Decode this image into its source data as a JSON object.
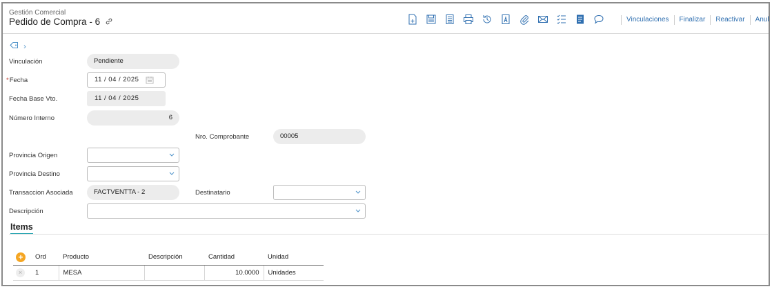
{
  "header": {
    "module": "Gestión Comercial",
    "title": "Pedido de Compra - 6",
    "actions": [
      "Vinculaciones",
      "Finalizar",
      "Reactivar",
      "Anular"
    ]
  },
  "toolbar_icons": [
    "new-document-icon",
    "save-icon",
    "copy-document-icon",
    "print-icon",
    "history-icon",
    "text-document-icon",
    "attach-icon",
    "mail-icon",
    "checklist-icon",
    "notes-icon",
    "comment-icon"
  ],
  "form": {
    "vinculacion": {
      "label": "Vinculación",
      "value": "Pendiente"
    },
    "fecha": {
      "label": "Fecha",
      "required_mark": "*",
      "value": "11 / 04 / 2025"
    },
    "fecha_base": {
      "label": "Fecha Base Vto.",
      "value": "11 / 04 / 2025"
    },
    "numero_interno": {
      "label": "Número Interno",
      "value": "6"
    },
    "nro_comprobante": {
      "label": "Nro. Comprobante",
      "value": "00005"
    },
    "provincia_origen": {
      "label": "Provincia Origen",
      "value": ""
    },
    "provincia_destino": {
      "label": "Provincia Destino",
      "value": ""
    },
    "transaccion": {
      "label": "Transaccion Asociada",
      "value": "FACTVENTTA - 2"
    },
    "destinatario": {
      "label": "Destinatario",
      "value": ""
    },
    "descripcion": {
      "label": "Descripción",
      "value": ""
    }
  },
  "items": {
    "title": "Items",
    "columns": [
      "Ord",
      "Producto",
      "Descripción",
      "Cantidad",
      "Unidad"
    ],
    "rows": [
      {
        "ord": "1",
        "producto": "MESA",
        "descripcion": "",
        "cantidad": "10.0000",
        "unidad": "Unidades"
      }
    ]
  },
  "colors": {
    "accent": "#2f6fb0",
    "tab_underline": "#2aa6b3",
    "add": "#f5a623"
  }
}
